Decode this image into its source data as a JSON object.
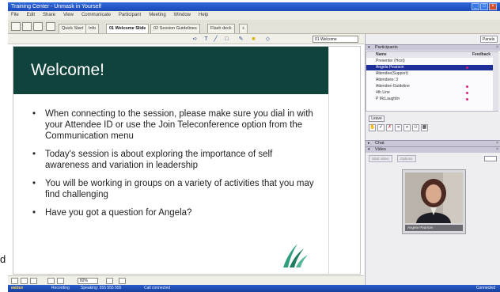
{
  "window": {
    "title": "Training Center - Unmask in Yourself",
    "controls": [
      "_",
      "□",
      "×"
    ]
  },
  "menu": [
    "File",
    "Edit",
    "Share",
    "View",
    "Communicate",
    "Participant",
    "Meeting",
    "Window",
    "Help"
  ],
  "tabs": [
    {
      "label": "Quick Start",
      "active": false
    },
    {
      "label": "Info",
      "active": false
    },
    {
      "label": "01 Welcome Slide",
      "active": true
    },
    {
      "label": "02 Session Guidelines",
      "active": false
    },
    {
      "label": "Flash deck",
      "active": false
    },
    {
      "label": "+",
      "active": false
    }
  ],
  "slide_toolbar": {
    "icons": [
      "pointer-icon",
      "text-icon",
      "line-icon",
      "shape-icon",
      "pen-icon",
      "highlight-icon",
      "eraser-icon"
    ],
    "page_select": "01 Welcome"
  },
  "slide": {
    "title": "Welcome!",
    "bullets": [
      "When connecting to the session, please make sure you dial in with your Attendee ID or use the Join Teleconference option from the Communication menu",
      "Today's session is about exploring the importance of self awareness and variation in leadership",
      "You will be working in groups on a variety of activities that you may find challenging",
      "Have you got a question for Angela?"
    ],
    "colors": {
      "header": "#10433c",
      "logo": "#2f9e7f"
    }
  },
  "edge_letter": "d",
  "bottom_tools": {
    "zoom": "82%"
  },
  "status": {
    "brand": "webex",
    "item1": "Recording",
    "item2": "Speaking: 555 555 555",
    "item3": "Call connected",
    "right": "Connected"
  },
  "panel": {
    "view_select": "Panels",
    "participants_header": "Participants",
    "columns": {
      "name": "Name",
      "feedback": "Feedback"
    },
    "rows": [
      {
        "label": "Presenter (Host)",
        "selected": false,
        "dot": false
      },
      {
        "label": "Angela Pearson",
        "selected": true,
        "dot": true
      },
      {
        "label": "Attendee(Support)",
        "selected": false,
        "dot": false
      },
      {
        "label": "Attendees: 3",
        "selected": false,
        "dot": false
      },
      {
        "label": "Attendee-Guideline",
        "selected": false,
        "dot": true
      },
      {
        "label": "4th Line",
        "selected": false,
        "dot": true
      },
      {
        "label": "P McLaughlin",
        "selected": false,
        "dot": true
      }
    ],
    "leave_button": "Leave",
    "chat_header": "Chat",
    "video_header": "Video",
    "video_buttons": [
      "Start video",
      "Options"
    ],
    "video_name": "Angela Pearson"
  }
}
